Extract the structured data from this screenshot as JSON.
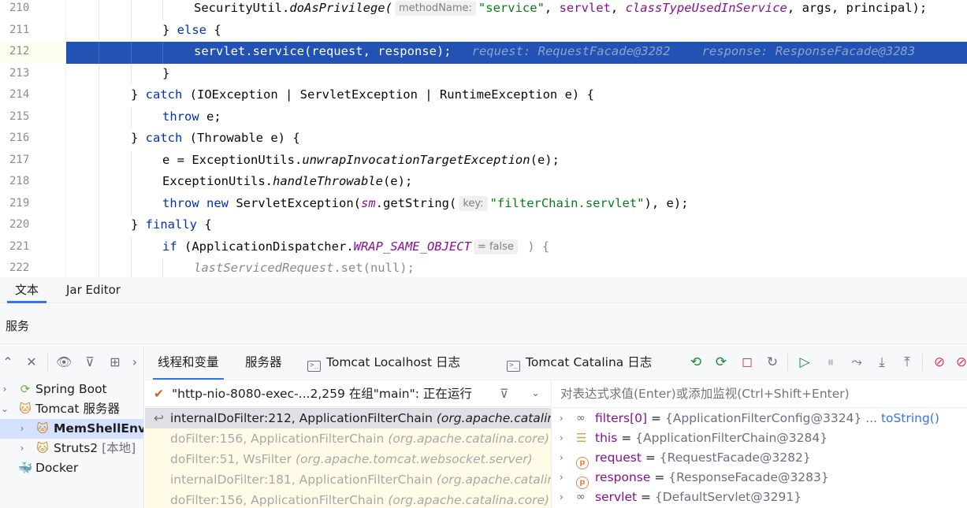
{
  "editor": {
    "lines": [
      {
        "num": "210"
      },
      {
        "num": "211"
      },
      {
        "num": "212"
      },
      {
        "num": "213"
      },
      {
        "num": "214"
      },
      {
        "num": "215"
      },
      {
        "num": "216"
      },
      {
        "num": "217"
      },
      {
        "num": "218"
      },
      {
        "num": "219"
      },
      {
        "num": "220"
      },
      {
        "num": "221"
      },
      {
        "num": "222"
      }
    ],
    "t": {
      "l210_a": "SecurityUtil.",
      "l210_b": "doAsPrivilege(",
      "l210_hint": "methodName:",
      "l210_c": "\"service\"",
      "l210_d": ", ",
      "l210_e": "servlet",
      "l210_f": ", ",
      "l210_g": "classTypeUsedInService",
      "l210_h": ", args, principal);",
      "l211_a": "} ",
      "l211_b": "else",
      "l211_c": " {",
      "l212_a": "servlet.service(request, response);",
      "l212_b": "request: RequestFacade@3282",
      "l212_c": "response: ResponseFacade@3283",
      "l213_a": "}",
      "l214_a": "} ",
      "l214_b": "catch",
      "l214_c": " (IOException | ServletException | RuntimeException e) {",
      "l215_a": "throw",
      "l215_b": " e;",
      "l216_a": "} ",
      "l216_b": "catch",
      "l216_c": " (Throwable e) {",
      "l217_a": "e = ExceptionUtils.",
      "l217_b": "unwrapInvocationTargetException",
      "l217_c": "(e);",
      "l218_a": "ExceptionUtils.",
      "l218_b": "handleThrowable",
      "l218_c": "(e);",
      "l219_a": "throw",
      "l219_b": " ",
      "l219_c": "new",
      "l219_d": " ServletException(",
      "l219_e": "sm",
      "l219_f": ".getString(",
      "l219_hint": "key:",
      "l219_g": "\"filterChain.servlet\"",
      "l219_h": "), e);",
      "l220_a": "} ",
      "l220_b": "finally",
      "l220_c": " {",
      "l221_a": "if",
      "l221_b": " (ApplicationDispatcher.",
      "l221_c": "WRAP_SAME_OBJECT",
      "l221_hint": "= false",
      "l221_d": " ) {",
      "l222_a": "lastServicedRequest",
      "l222_b": ".set(null);"
    }
  },
  "editor_tabs": [
    {
      "label": "文本",
      "active": true
    },
    {
      "label": "Jar Editor",
      "active": false
    }
  ],
  "services": {
    "title": "服务",
    "tree": [
      {
        "label": "Spring Boot",
        "icon": "spring-boot-icon"
      },
      {
        "label": "Tomcat 服务器",
        "icon": "tomcat-icon"
      },
      {
        "label": "MemShellEnv",
        "icon": "tomcat-artifact-icon",
        "selected": true
      },
      {
        "label": "Struts2",
        "local": "[本地]",
        "icon": "tomcat-artifact-icon"
      },
      {
        "label": "Docker",
        "icon": "docker-icon"
      }
    ]
  },
  "debug_tabs": [
    {
      "label": "线程和变量",
      "active": true
    },
    {
      "label": "服务器"
    },
    {
      "label": "Tomcat Localhost 日志"
    },
    {
      "label": "Tomcat Catalina 日志"
    }
  ],
  "thread": {
    "label": "\"http-nio-8080-exec-...2,259 在组\"main\": 正在运行"
  },
  "frames": [
    {
      "method": "internalDoFilter:212, ApplicationFilterChain",
      "pkg": "(org.apache.catalina.core)",
      "current": true
    },
    {
      "method": "doFilter:156, ApplicationFilterChain",
      "pkg": "(org.apache.catalina.core)"
    },
    {
      "method": "doFilter:51, WsFilter",
      "pkg": "(org.apache.tomcat.websocket.server)"
    },
    {
      "method": "internalDoFilter:181, ApplicationFilterChain",
      "pkg": "(org.apache.catalina.core)"
    },
    {
      "method": "doFilter:156, ApplicationFilterChain",
      "pkg": "(org.apache.catalina.core)"
    }
  ],
  "variables": {
    "eval_placeholder": "对表达式求值(Enter)或添加监视(Ctrl+Shift+Enter)",
    "items": [
      {
        "name": "filters[0]",
        "eq": " = ",
        "value": "{ApplicationFilterConfig@3324}",
        "link": " ... toString()",
        "icon": "watch-icon"
      },
      {
        "name": "this",
        "eq": " = ",
        "value": "{ApplicationFilterChain@3284}",
        "icon": "this-object-icon"
      },
      {
        "name": "request",
        "eq": " = ",
        "value": "{RequestFacade@3282}",
        "icon": "parameter-icon"
      },
      {
        "name": "response",
        "eq": " = ",
        "value": "{ResponseFacade@3283}",
        "icon": "parameter-icon"
      },
      {
        "name": "servlet",
        "eq": " = ",
        "value": "{DefaultServlet@3291}",
        "icon": "field-watch-icon"
      }
    ]
  },
  "colors": {
    "current_line": "#2152b4",
    "accent": "#3574f0",
    "keyword": "#0033b3",
    "string": "#067d17",
    "field": "#871094"
  }
}
